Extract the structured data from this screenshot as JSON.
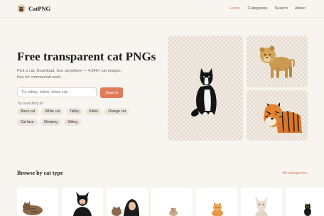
{
  "brand": {
    "name": "CatPNG"
  },
  "nav": {
    "links": [
      {
        "label": "Home"
      },
      {
        "label": "Categories"
      },
      {
        "label": "Search"
      },
      {
        "label": "About"
      }
    ]
  },
  "hero": {
    "title": "Free transparent cat PNGs",
    "subtitle": "Pick a cat. Download. Use anywhere — 4,846+ cat images, free for commercial work.",
    "search": {
      "placeholder": "Try tabby, kitten, white cat...",
      "button_label": "Search"
    },
    "try_label": "Try searching for",
    "chips": [
      "Black cat",
      "White cat",
      "Tabby",
      "Kitten",
      "Orange cat",
      "Cat face",
      "Sleeping",
      "Sitting"
    ]
  },
  "showcase": {
    "images": [
      {
        "icon": "black-white-cat-image"
      },
      {
        "icon": "lion-cub-image"
      },
      {
        "icon": "tiger-image"
      }
    ]
  },
  "categories_section": {
    "title": "Browse by cat type",
    "all_label": "All categories",
    "cards": [
      {
        "icon": "tabby-cat-thumbnail"
      },
      {
        "icon": "catwoman-thumbnail"
      },
      {
        "icon": "cat-portrait-thumbnail"
      },
      {
        "icon": "small-cat-thumbnail"
      },
      {
        "icon": "orange-kitten-thumbnail"
      },
      {
        "icon": "sphynx-cat-thumbnail"
      },
      {
        "icon": "black-cat-thumbnail"
      }
    ]
  },
  "colors": {
    "accent": "#e07a59",
    "background": "#f8f5f1",
    "chip": "#ece5dd"
  }
}
